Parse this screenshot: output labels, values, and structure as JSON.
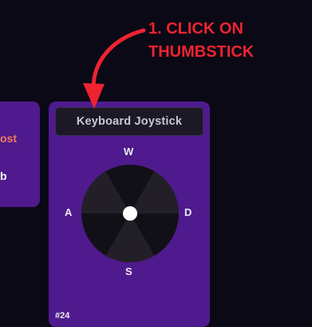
{
  "annotation": {
    "line1": "1. CLICK ON",
    "line2": "THUMBSTICK",
    "color": "#ee2330"
  },
  "left_card": {
    "line1": "ost",
    "line2": "b"
  },
  "joystick_card": {
    "title": "Keyboard Joystick",
    "keys": {
      "up": "W",
      "left": "A",
      "right": "D",
      "down": "S"
    },
    "number": "#24",
    "colors": {
      "card": "#4f1a8d",
      "title_bg": "#1c1826",
      "pad_dark": "#121017",
      "pad_light": "#221f28",
      "knob": "#ffffff"
    }
  },
  "icons": {
    "arrow": "curved-arrow-icon",
    "knob": "thumbstick-knob-icon"
  }
}
